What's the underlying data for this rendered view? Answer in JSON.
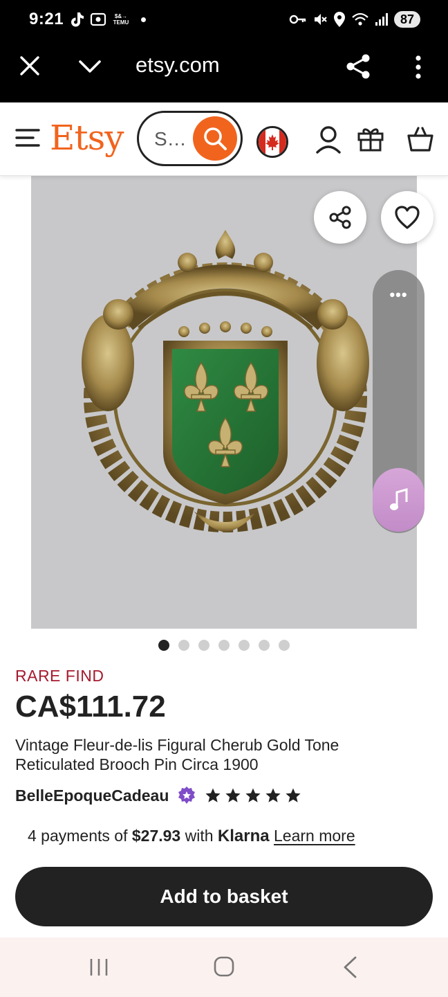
{
  "status_bar": {
    "time": "9:21",
    "temu_badge_line1": "$&→",
    "temu_badge_line2": "TEMU",
    "battery": "87",
    "icons": [
      "tiktok-icon",
      "temu-icon",
      "key-icon",
      "mute-icon",
      "location-icon",
      "wifi-icon",
      "signal-icon",
      "battery-icon"
    ]
  },
  "browser": {
    "url": "etsy.com",
    "icons": [
      "close-icon",
      "chevron-down-icon",
      "share-icon",
      "more-vert-icon"
    ]
  },
  "header": {
    "logo": "Etsy",
    "search_placeholder": "S…",
    "icons": [
      "menu-icon",
      "search-icon",
      "canada-flag-icon",
      "account-icon",
      "gift-icon",
      "basket-icon"
    ],
    "accent_color": "#f1641e"
  },
  "gallery": {
    "image_count": 7,
    "active_index": 0,
    "panel_dots": "•••"
  },
  "product": {
    "badge": "RARE FIND",
    "price": "CA$111.72",
    "title": "Vintage Fleur-de-lis Figural Cherub Gold Tone Reticulated Brooch Pin Circa 1900",
    "shop_name": "BelleEpoqueCadeau",
    "rating_stars": 5,
    "badge_color": "#a61a2e"
  },
  "klarna": {
    "prefix": "4 payments of ",
    "amount": "$27.93",
    "middle": " with ",
    "brand": "Klarna",
    "link": "Learn more"
  },
  "actions": {
    "add_to_basket": "Add to basket"
  }
}
